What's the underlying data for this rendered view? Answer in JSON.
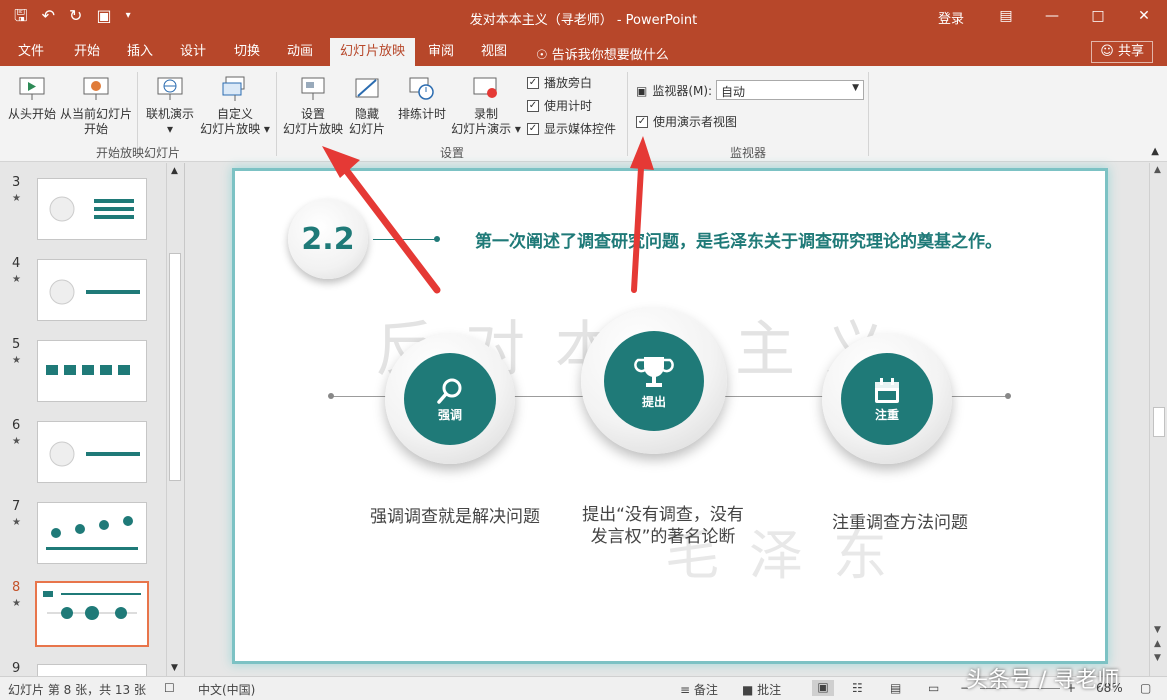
{
  "window": {
    "title": "发对本本主义（寻老师） - PowerPoint",
    "login": "登录",
    "share": "共享"
  },
  "tabs": [
    "文件",
    "开始",
    "插入",
    "设计",
    "切换",
    "动画",
    "幻灯片放映",
    "审阅",
    "视图"
  ],
  "active_tab": "幻灯片放映",
  "tellme": "告诉我你想要做什么",
  "ribbon": {
    "from_beginning": "从头开始",
    "from_current_1": "从当前幻灯片",
    "from_current_2": "开始",
    "online_present": "联机演示",
    "custom_show_1": "自定义",
    "custom_show_2": "幻灯片放映",
    "group_start": "开始放映幻灯片",
    "setup_1": "设置",
    "setup_2": "幻灯片放映",
    "hide_1": "隐藏",
    "hide_2": "幻灯片",
    "rehearse": "排练计时",
    "record_1": "录制",
    "record_2": "幻灯片演示",
    "play_narration": "播放旁白",
    "use_timings": "使用计时",
    "show_media": "显示媒体控件",
    "group_setup": "设置",
    "monitor_label": "监视器(M):",
    "monitor_value": "自动",
    "presenter_view": "使用演示者视图",
    "group_monitor": "监视器"
  },
  "thumbnails": {
    "numbers": [
      "3",
      "4",
      "5",
      "6",
      "7",
      "8",
      "9"
    ],
    "selected": "8"
  },
  "slide": {
    "badge": "2.2",
    "headline": "第一次阐述了调查研究问题，是毛泽东关于调查研究理论的奠基之作。",
    "watermark_top": "反对本本主义",
    "watermark_bottom": "毛泽东",
    "circle1_label": "强调",
    "circle2_label": "提出",
    "circle3_label": "注重",
    "caption1": "强调调查就是解决问题",
    "caption2_line1": "提出“没有调查，没有",
    "caption2_line2": "发言权”的著名论断",
    "caption3": "注重调查方法问题"
  },
  "status": {
    "slide_info": "幻灯片 第 8 张，共 13 张",
    "language": "中文(中国)",
    "notes": "备注",
    "comments": "批注",
    "zoom": "68%"
  },
  "brand_watermark": "头条号 / 寻老师",
  "colors": {
    "titlebar": "#b7472a",
    "teal": "#1f7a78",
    "arrow": "#e53935"
  }
}
